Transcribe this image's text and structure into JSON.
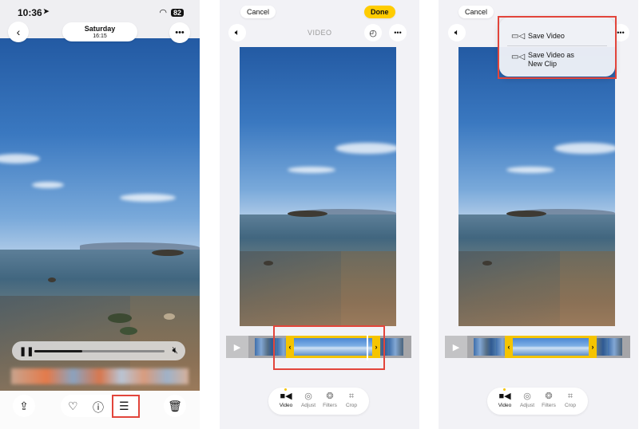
{
  "panel1": {
    "status": {
      "time": "10:36",
      "location_icon": "location-arrow-icon",
      "wifi_icon": "wifi-icon",
      "battery": "82"
    },
    "header": {
      "back_icon": "chevron-left-icon",
      "date": "Saturday",
      "time": "16:15",
      "more_icon": "ellipsis-icon"
    },
    "player": {
      "pause_icon": "pause-icon",
      "progress": 0.37,
      "mute_icon": "speaker-muted-icon"
    },
    "toolbar": {
      "share_icon": "share-icon",
      "favorite_icon": "heart-icon",
      "info_icon": "info-icon",
      "edit_icon": "sliders-icon",
      "delete_icon": "trash-icon"
    }
  },
  "panel2": {
    "cancel_label": "Cancel",
    "done_label": "Done",
    "title": "VIDEO",
    "icons": {
      "sound": "speaker-icon",
      "speed": "gauge-icon",
      "more": "ellipsis-icon",
      "play": "play-icon"
    },
    "modes": [
      {
        "label": "Video",
        "icon": "video-camera-icon",
        "active": true
      },
      {
        "label": "Adjust",
        "icon": "adjust-dial-icon",
        "active": false
      },
      {
        "label": "Filters",
        "icon": "filters-icon",
        "active": false
      },
      {
        "label": "Crop",
        "icon": "crop-icon",
        "active": false
      }
    ]
  },
  "panel3": {
    "cancel_label": "Cancel",
    "menu": [
      {
        "label": "Save Video",
        "icon": "save-video-icon"
      },
      {
        "label": "Save Video as New Clip",
        "icon": "save-clip-icon"
      }
    ],
    "modes": [
      {
        "label": "Video",
        "icon": "video-camera-icon",
        "active": true
      },
      {
        "label": "Adjust",
        "icon": "adjust-dial-icon",
        "active": false
      },
      {
        "label": "Filters",
        "icon": "filters-icon",
        "active": false
      },
      {
        "label": "Crop",
        "icon": "crop-icon",
        "active": false
      }
    ]
  },
  "colors": {
    "highlight_box": "#e2453b",
    "accent_yellow": "#f5c400"
  }
}
